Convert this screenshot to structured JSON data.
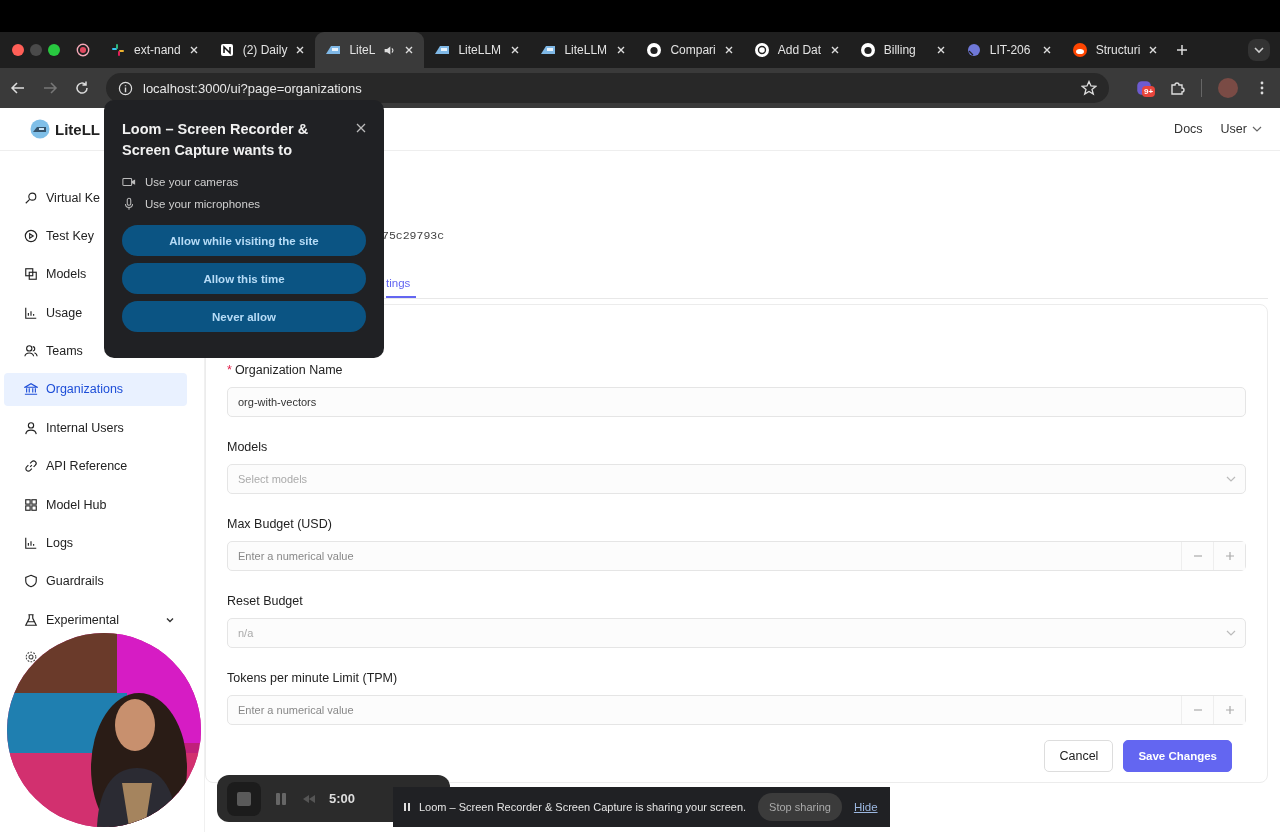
{
  "browser": {
    "tabs": [
      {
        "label": "ext-nand",
        "kind": "slack",
        "selected": false,
        "audio": false
      },
      {
        "label": "(2) Daily",
        "kind": "notion",
        "selected": false,
        "audio": false
      },
      {
        "label": "LiteL",
        "kind": "litellm",
        "selected": true,
        "audio": true
      },
      {
        "label": "LiteLLM",
        "kind": "litellm",
        "selected": false,
        "audio": false
      },
      {
        "label": "LiteLLM",
        "kind": "litellm",
        "selected": false,
        "audio": false
      },
      {
        "label": "Compari",
        "kind": "github",
        "selected": false,
        "audio": false
      },
      {
        "label": "Add Dat",
        "kind": "openai",
        "selected": false,
        "audio": false
      },
      {
        "label": "Billing",
        "kind": "github",
        "selected": false,
        "audio": false
      },
      {
        "label": "LIT-206",
        "kind": "linear",
        "selected": false,
        "audio": false
      },
      {
        "label": "Structuri",
        "kind": "reddit",
        "selected": false,
        "audio": false
      }
    ],
    "url": "localhost:3000/ui?page=organizations",
    "extension_badge": "9+"
  },
  "header": {
    "logo": "LiteLL",
    "links": [
      "Docs"
    ],
    "user": "User"
  },
  "sidebar": {
    "items": [
      {
        "label": "Virtual Ke",
        "kind": "key",
        "selected": false,
        "has_submenu": false
      },
      {
        "label": "Test Key",
        "kind": "play",
        "selected": false,
        "has_submenu": false
      },
      {
        "label": "Models",
        "kind": "models",
        "selected": false,
        "has_submenu": false
      },
      {
        "label": "Usage",
        "kind": "chart",
        "selected": false,
        "has_submenu": false
      },
      {
        "label": "Teams",
        "kind": "users",
        "selected": false,
        "has_submenu": false
      },
      {
        "label": "Organizations",
        "kind": "bank",
        "selected": true,
        "has_submenu": false
      },
      {
        "label": "Internal Users",
        "kind": "user",
        "selected": false,
        "has_submenu": false
      },
      {
        "label": "API Reference",
        "kind": "link",
        "selected": false,
        "has_submenu": false
      },
      {
        "label": "Model Hub",
        "kind": "grid",
        "selected": false,
        "has_submenu": false
      },
      {
        "label": "Logs",
        "kind": "chart",
        "selected": false,
        "has_submenu": false
      },
      {
        "label": "Guardrails",
        "kind": "shield",
        "selected": false,
        "has_submenu": false
      },
      {
        "label": "Experimental",
        "kind": "flask",
        "selected": false,
        "has_submenu": true
      }
    ]
  },
  "main": {
    "id_fragment": "75c29793c",
    "tabs": [
      {
        "label": "tings",
        "selected": true
      }
    ],
    "form": {
      "fields": [
        {
          "kind": "text",
          "label": "Organization Name",
          "required_mark": "*",
          "value": "org-with-vectors"
        },
        {
          "kind": "select",
          "label": "Models",
          "placeholder": "Select models"
        },
        {
          "kind": "number",
          "label": "Max Budget (USD)",
          "placeholder": "Enter a numerical value"
        },
        {
          "kind": "select",
          "label": "Reset Budget",
          "placeholder": "n/a"
        },
        {
          "kind": "number",
          "label": "Tokens per minute Limit (TPM)",
          "placeholder": "Enter a numerical value"
        }
      ],
      "buttons": [
        {
          "label": "Cancel",
          "kind": "secondary"
        },
        {
          "label": "Save Changes",
          "kind": "primary"
        }
      ]
    }
  },
  "permission_prompt": {
    "title": "Loom – Screen Recorder & Screen Capture wants to",
    "permissions": [
      {
        "kind": "camera",
        "label": "Use your cameras"
      },
      {
        "kind": "microphone",
        "label": "Use your microphones"
      }
    ],
    "buttons": [
      "Allow while visiting the site",
      "Allow this time",
      "Never allow"
    ]
  },
  "recorder": {
    "time": "5:00"
  },
  "sharing_bar": {
    "message": "Loom – Screen Recorder & Screen Capture is sharing your screen.",
    "stop": "Stop sharing",
    "hide": "Hide"
  }
}
